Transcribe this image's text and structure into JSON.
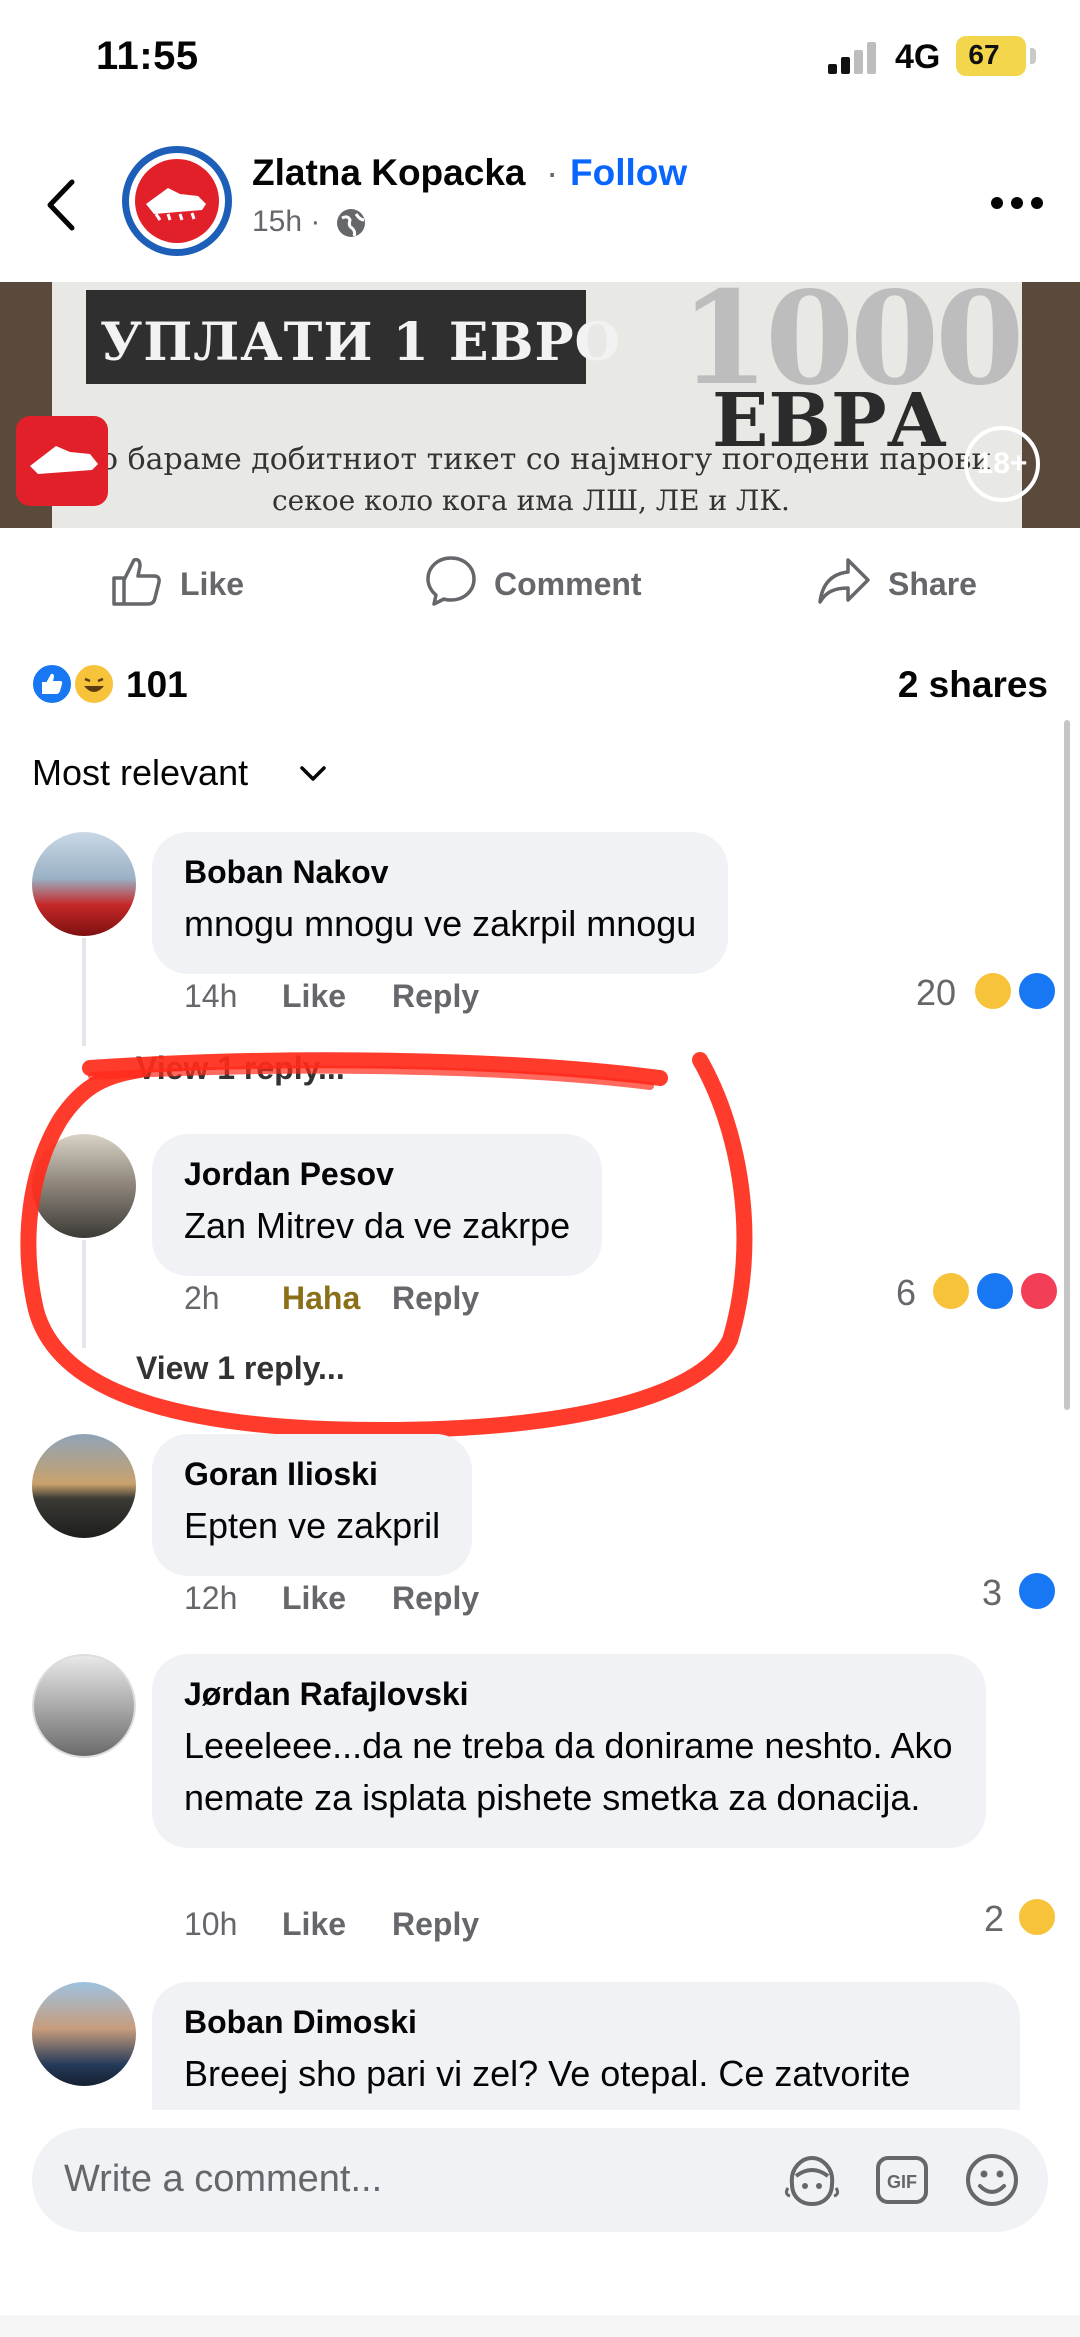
{
  "status_bar": {
    "time": "11:55",
    "network": "4G",
    "battery": "67"
  },
  "header": {
    "page_name": "Zlatna Kopacka",
    "separator": "·",
    "follow_label": "Follow",
    "time": "15h ·",
    "icons": [
      "back-arrow-icon",
      "globe-icon",
      "more-icon"
    ]
  },
  "post_image": {
    "band_text": "УПЛАТИ 1 ЕВРО",
    "big_text": "1000",
    "currency_text": "ЕВРА",
    "line1": "о бараме добитниот тикет со најмногу погодени парови",
    "line2": "секое коло кога има ЛШ, ЛЕ и ЛК.",
    "age_badge": "18+"
  },
  "actions": {
    "like": "Like",
    "comment": "Comment",
    "share": "Share"
  },
  "summary": {
    "reaction_count": "101",
    "shares": "2 shares",
    "reactions": [
      "like",
      "haha"
    ]
  },
  "sort_label": "Most relevant",
  "comments": [
    {
      "name": "Boban Nakov",
      "text": "mnogu mnogu ve zakrpil mnogu",
      "time": "14h",
      "like_label": "Like",
      "reply_label": "Reply",
      "count": "20",
      "reactions": [
        "haha",
        "like"
      ],
      "view_replies": "View 1 reply..."
    },
    {
      "name": "Jordan Pesov",
      "text": "Zan Mitrev da ve zakrpe",
      "time": "2h",
      "like_label": "Haha",
      "reply_label": "Reply",
      "count": "6",
      "reactions": [
        "haha",
        "like",
        "love"
      ],
      "view_replies": "View 1 reply..."
    },
    {
      "name": "Goran Ilioski",
      "text": "Epten ve zakpril",
      "time": "12h",
      "like_label": "Like",
      "reply_label": "Reply",
      "count": "3",
      "reactions": [
        "like"
      ]
    },
    {
      "name": "Jørdan Rafajlovski",
      "text": "Leeeleee...da ne treba da donirame neshto. Ako nemate za isplata pishete smetka za donacija.",
      "time": "10h",
      "like_label": "Like",
      "reply_label": "Reply",
      "count": "2",
      "reactions": [
        "haha"
      ]
    },
    {
      "name": "Boban Dimoski",
      "text": "Breeej sho pari vi zel? Ve otepal. Ce zatvorite"
    }
  ],
  "composer": {
    "placeholder": "Write a comment...",
    "icons": [
      "avatar-sticker-icon",
      "gif-icon",
      "emoji-icon"
    ]
  },
  "colors": {
    "accent": "#0866ff",
    "bubble": "#f0f2f5",
    "meta": "#65676b",
    "annotation": "#ff2a1a"
  }
}
